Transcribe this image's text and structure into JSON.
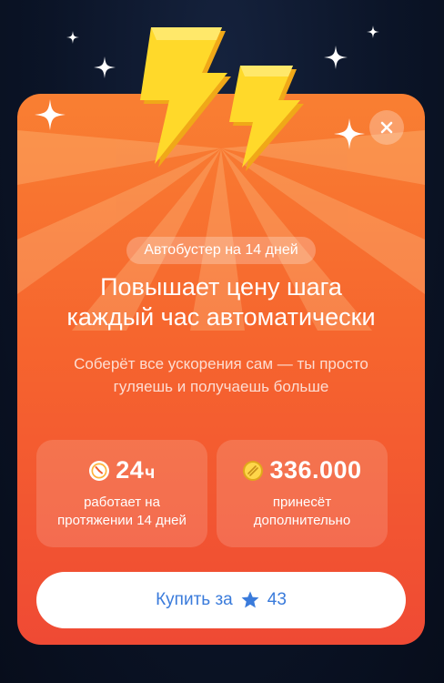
{
  "promo": {
    "badge": "Автобустер на 14 дней",
    "title_line1": "Повышает цену шага",
    "title_line2": "каждый час автоматически",
    "subtitle_line1": "Соберёт все ускорения сам — ты просто",
    "subtitle_line2": "гуляешь и получаешь больше"
  },
  "stats": [
    {
      "icon": "clock-icon",
      "value": "24",
      "unit": "ч",
      "desc_line1": "работает на",
      "desc_line2": "протяжении 14 дней"
    },
    {
      "icon": "coin-icon",
      "value": "336.000",
      "desc_line1": "принесёт",
      "desc_line2": "дополнительно"
    }
  ],
  "buy": {
    "label": "Купить за",
    "icon": "star-icon",
    "price": "43"
  },
  "close_icon": "close-icon",
  "hero_icon": "lightning-bolts-icon",
  "colors": {
    "card_top": "#f97f32",
    "card_bottom": "#ef4a34",
    "bolt": "#ffd21f",
    "button_text": "#3a7bdb",
    "background": "#0b1427"
  }
}
